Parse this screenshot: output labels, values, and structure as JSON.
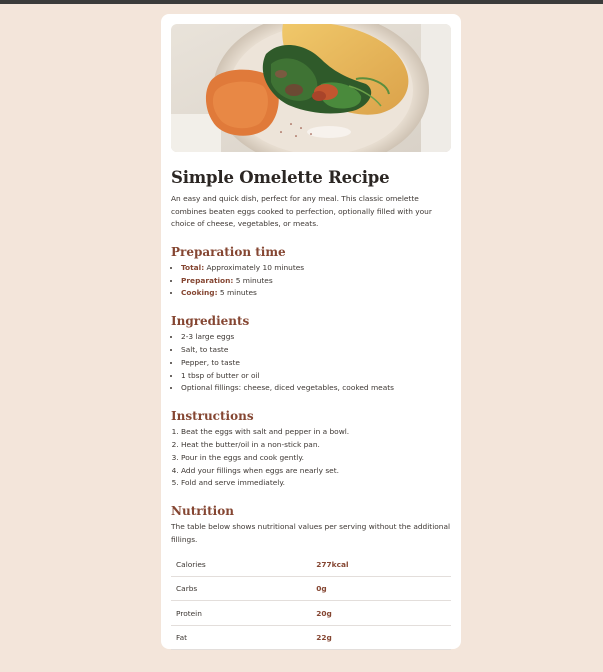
{
  "title": "Simple Omelette Recipe",
  "intro": "An easy and quick dish, perfect for any meal. This classic omelette combines beaten eggs cooked to perfection, optionally filled with your choice of cheese, vegetables, or meats.",
  "preparation": {
    "heading": "Preparation time",
    "items": [
      {
        "label": "Total:",
        "value": " Approximately 10 minutes"
      },
      {
        "label": "Preparation:",
        "value": " 5 minutes"
      },
      {
        "label": "Cooking:",
        "value": " 5 minutes"
      }
    ]
  },
  "ingredients": {
    "heading": "Ingredients",
    "items": [
      "2-3 large eggs",
      "Salt, to taste",
      "Pepper, to taste",
      "1 tbsp of butter or oil",
      "Optional fillings: cheese, diced vegetables, cooked meats"
    ]
  },
  "instructions": {
    "heading": "Instructions",
    "items": [
      "Beat the eggs with salt and pepper in a bowl.",
      "Heat the butter/oil in a non-stick pan.",
      "Pour in the eggs and cook gently.",
      "Add your fillings when eggs are nearly set.",
      "Fold and serve immediately."
    ]
  },
  "nutrition": {
    "heading": "Nutrition",
    "intro": "The table below shows nutritional values per serving without the additional fillings.",
    "rows": [
      {
        "name": "Calories",
        "value": "277kcal"
      },
      {
        "name": "Carbs",
        "value": "0g"
      },
      {
        "name": "Protein",
        "value": "20g"
      },
      {
        "name": "Fat",
        "value": "22g"
      }
    ]
  },
  "colors": {
    "page_background": "#f3e5da",
    "card_background": "#ffffff",
    "heading_accent": "#854632",
    "text": "#3d3733"
  }
}
